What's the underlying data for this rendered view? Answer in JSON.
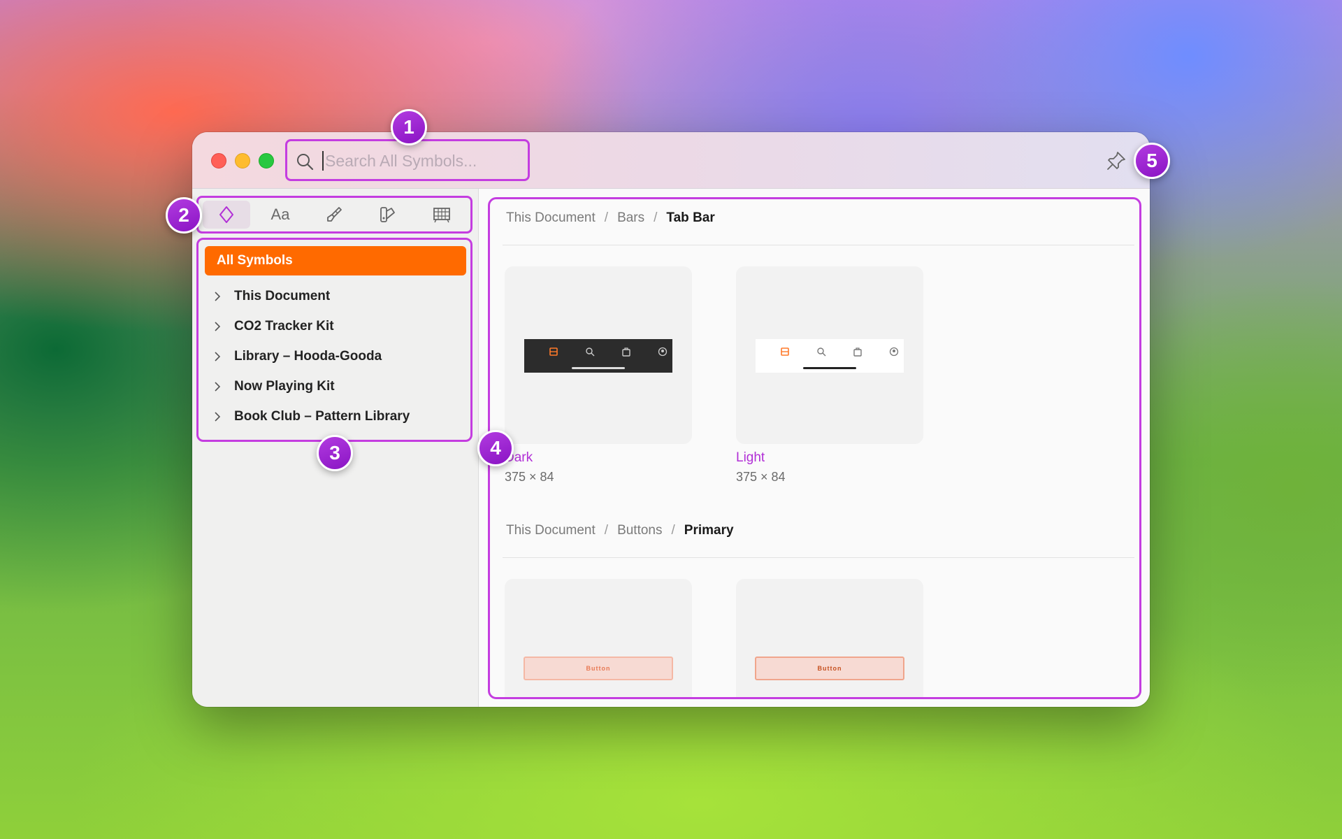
{
  "window": {
    "search": {
      "placeholder": "Search All Symbols..."
    }
  },
  "badges": [
    "1",
    "2",
    "3",
    "4",
    "5"
  ],
  "sidebar": {
    "tabs": [
      {
        "icon": "symbol-diamond-icon"
      },
      {
        "icon": "text-styles-icon",
        "label": "Aa"
      },
      {
        "icon": "paintbrush-icon"
      },
      {
        "icon": "color-swatch-icon"
      },
      {
        "icon": "grid-layout-icon"
      }
    ],
    "all_label": "All Symbols",
    "libraries": [
      "This Document",
      "CO2 Tracker Kit",
      "Library – Hooda-Gooda",
      "Now Playing Kit",
      "Book Club – Pattern Library"
    ]
  },
  "content": {
    "sections": [
      {
        "breadcrumb": [
          "This Document",
          "Bars",
          "Tab Bar"
        ],
        "items": [
          {
            "name": "Dark",
            "size": "375 × 84"
          },
          {
            "name": "Light",
            "size": "375 × 84"
          }
        ]
      },
      {
        "breadcrumb": [
          "This Document",
          "Buttons",
          "Primary"
        ],
        "items": [
          {
            "preview_label": "Button"
          },
          {
            "preview_label": "Button"
          }
        ]
      }
    ]
  },
  "colors": {
    "accent": "#ff6a00",
    "annotation": "#c43de0",
    "item_name": "#b12fd6"
  }
}
